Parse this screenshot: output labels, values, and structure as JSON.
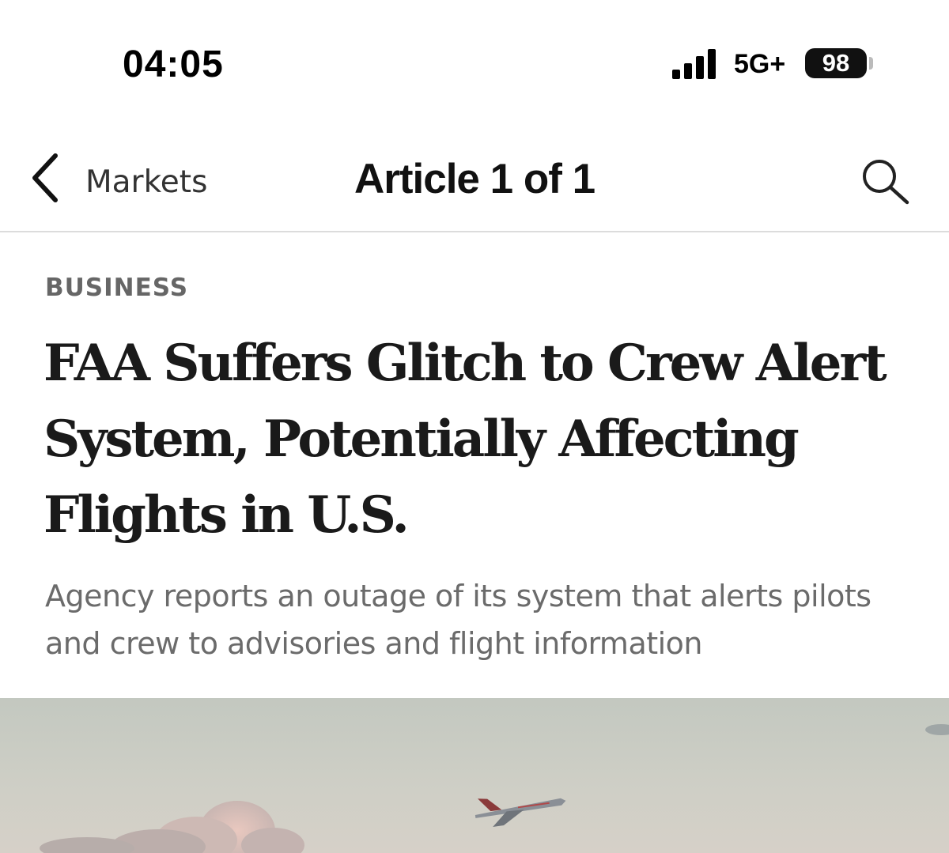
{
  "status_bar": {
    "time": "04:05",
    "network": "5G+",
    "battery": "98",
    "signal_icon": "signal-bars-icon",
    "battery_icon": "battery-icon"
  },
  "nav": {
    "back_label": "Markets",
    "title": "Article 1 of 1",
    "back_icon": "chevron-left-icon",
    "search_icon": "search-icon"
  },
  "article": {
    "section": "BUSINESS",
    "headline": "FAA Suffers Glitch to Crew Alert System, Potentially Affecting Flights in U.S.",
    "dek": "Agency reports an outage of its system that alerts pilots and crew to advisories and flight information"
  },
  "colors": {
    "section_label": "#666666",
    "headline": "#1a1a1a",
    "dek": "#6b6b6b",
    "sky": "#c9cbc3"
  }
}
